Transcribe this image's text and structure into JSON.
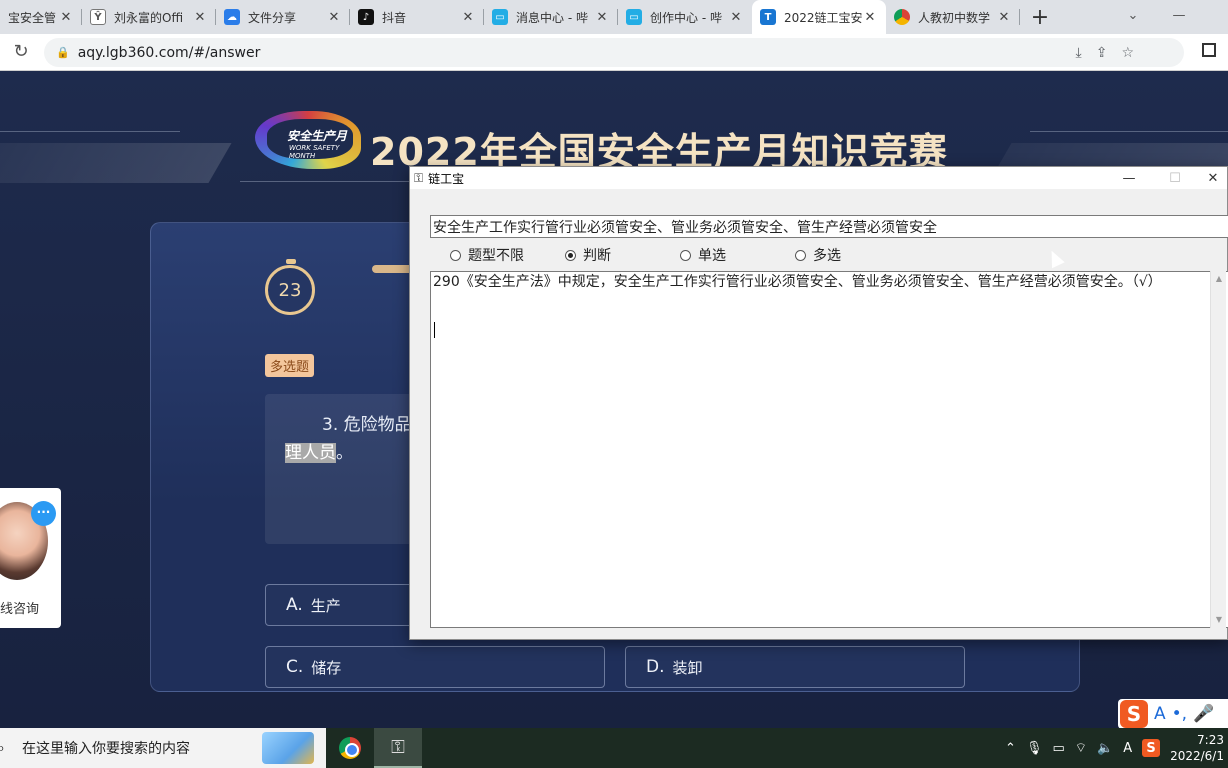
{
  "browser": {
    "tabs": [
      {
        "title": "宝安全管",
        "icon": "shield-favicon",
        "color": "#3a7bd5"
      },
      {
        "title": "刘永富的Offi",
        "icon": "office-favicon",
        "color": "#555555"
      },
      {
        "title": "文件分享",
        "icon": "cloud-favicon",
        "color": "#2b7de9"
      },
      {
        "title": "抖音",
        "icon": "tiktok-favicon",
        "color": "#111111"
      },
      {
        "title": "消息中心 - 哔",
        "icon": "bilibili-favicon",
        "color": "#23ade5"
      },
      {
        "title": "创作中心 - 哔",
        "icon": "bilibili-favicon",
        "color": "#23ade5"
      },
      {
        "title": "2022链工宝安",
        "icon": "lgb-favicon",
        "color": "#1976d2"
      },
      {
        "title": "人教初中数学",
        "icon": "chrome-favicon",
        "color": "#4caf50"
      }
    ],
    "active_tab": 6,
    "new_tab": "+",
    "url": "aqy.lgb360.com/#/answer"
  },
  "page": {
    "logo": {
      "text": "安全生产月",
      "subtext": "WORK SAFETY MONTH"
    },
    "title": "2022年全国安全生产月知识竞赛",
    "timer": "23",
    "question_type": "多选题",
    "question_line1": "3. 危险物品",
    "question_line2_highlight": "理人员",
    "question_line2_end": "。",
    "options": [
      {
        "letter": "A.",
        "text": "生产"
      },
      {
        "letter": "C.",
        "text": "储存"
      },
      {
        "letter": "D.",
        "text": "装卸"
      }
    ],
    "chat_widget": {
      "label": "线咨询",
      "bubble": "···"
    }
  },
  "dialog": {
    "title": "链工宝",
    "search_value": "安全生产工作实行管行业必须管安全、管业务必须管安全、管生产经营必须管安全",
    "radio_options": [
      {
        "label": "题型不限",
        "selected": false
      },
      {
        "label": "判断",
        "selected": true
      },
      {
        "label": "单选",
        "selected": false
      },
      {
        "label": "多选",
        "selected": false
      }
    ],
    "result_text": "290《安全生产法》中规定，安全生产工作实行管行业必须管安全、管业务必须管安全、管生产经营必须管安全。（√）"
  },
  "taskbar": {
    "search_placeholder": "在这里输入你要搜索的内容",
    "time": "7:23",
    "date": "2022/6/1",
    "ime_label": "A"
  }
}
